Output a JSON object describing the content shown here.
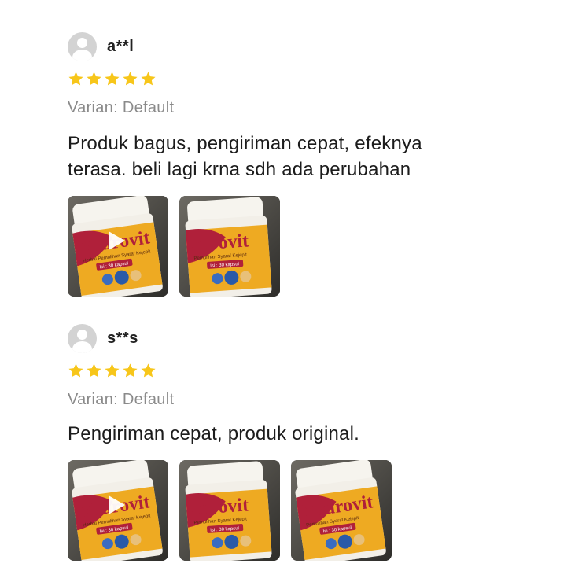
{
  "reviews": [
    {
      "username": "a**l",
      "rating": 5,
      "variant": "Varian: Default",
      "comment_lines": [
        "Produk bagus, pengiriman cepat, efeknya",
        "terasa. beli lagi krna sdh ada perubahan"
      ],
      "media": [
        {
          "kind": "video",
          "label": "Neurovit",
          "sub": "Herbal Pemulihan Syaraf Kejepit",
          "count": "Isi : 30 kapsul"
        },
        {
          "kind": "photo",
          "label": "eurovit",
          "sub": "Pemulihan Syaraf Kejepit",
          "count": "Isi : 30 kapsul"
        }
      ]
    },
    {
      "username": "s**s",
      "rating": 5,
      "variant": "Varian: Default",
      "comment_lines": [
        "Pengiriman cepat, produk original."
      ],
      "media": [
        {
          "kind": "video",
          "label": "Neurovit",
          "sub": "Herbal Pemulihan Syaraf Kejepit",
          "count": "Isi : 30 kapsul"
        },
        {
          "kind": "photo",
          "label": "eurovit",
          "sub": "Pemulihan Syaraf Kejepit",
          "count": "Isi : 30 kapsul"
        },
        {
          "kind": "photo",
          "label": "Neurovit",
          "sub": "Pemulihan Syaraf Kejepit",
          "count": "Isi : 30 kapsul"
        }
      ]
    }
  ],
  "colors": {
    "star": "#f7c61a",
    "label_red": "#b0203a",
    "jar_orange": "#eeaa22",
    "avatar": "#d3d3d3"
  },
  "icons": {
    "avatar": "default-user-avatar",
    "star": "star-filled-icon",
    "play": "play-icon"
  }
}
